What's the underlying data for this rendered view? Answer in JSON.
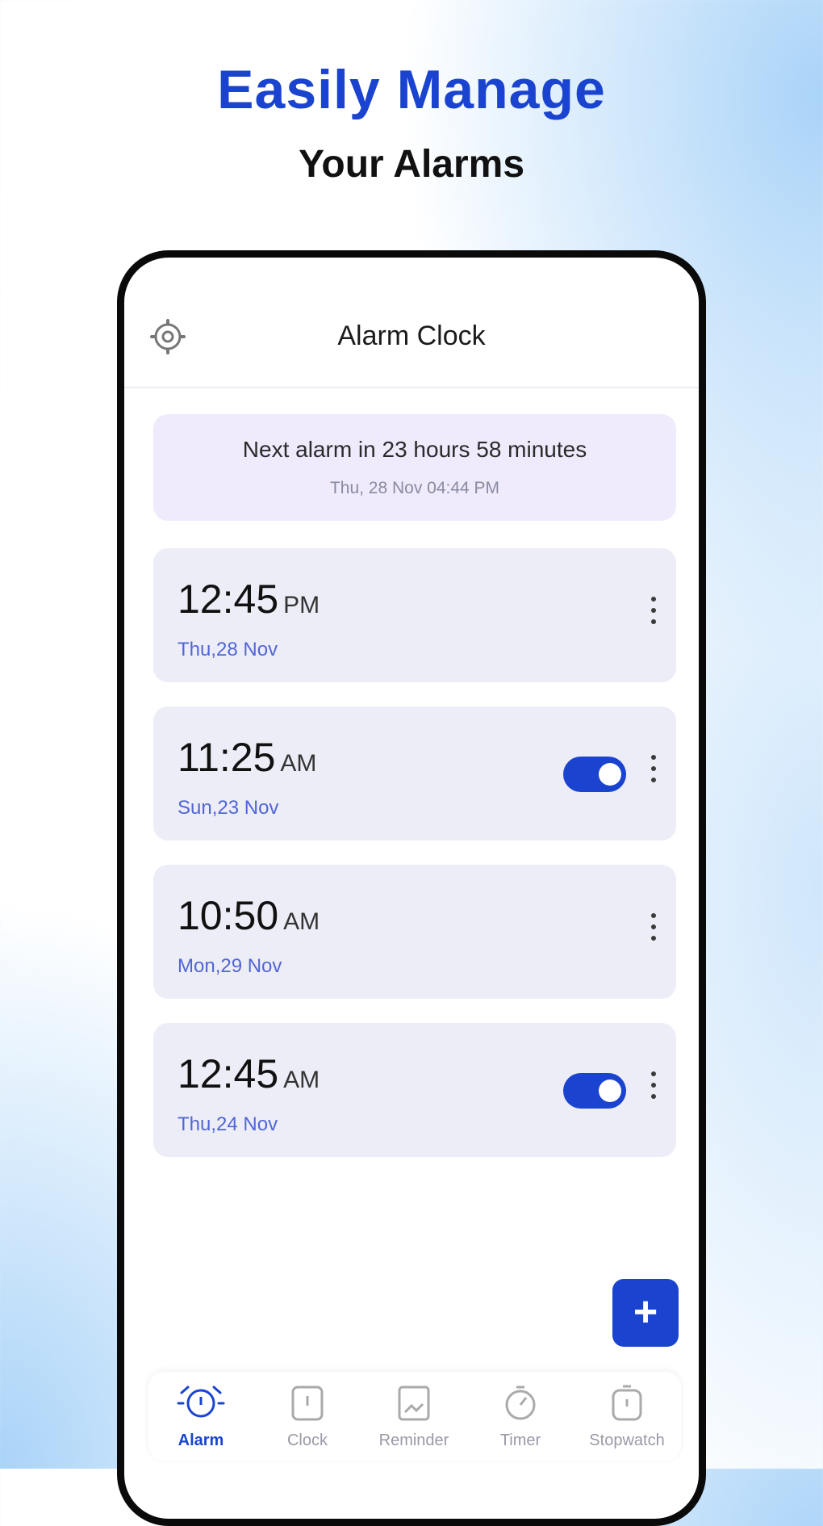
{
  "headline": {
    "title": "Easily Manage",
    "subtitle": "Your Alarms"
  },
  "app": {
    "title": "Alarm Clock",
    "settings_icon": "gear-icon"
  },
  "next_alarm": {
    "text": "Next alarm in 23 hours 58 minutes",
    "when": "Thu, 28 Nov 04:44 PM"
  },
  "alarms": [
    {
      "time": "12:45",
      "ampm": "PM",
      "date": "Thu,28 Nov",
      "toggle_visible": false
    },
    {
      "time": "11:25",
      "ampm": "AM",
      "date": "Sun,23 Nov",
      "toggle_visible": true,
      "enabled": true
    },
    {
      "time": "10:50",
      "ampm": "AM",
      "date": "Mon,29 Nov",
      "toggle_visible": false
    },
    {
      "time": "12:45",
      "ampm": "AM",
      "date": "Thu,24 Nov",
      "toggle_visible": true,
      "enabled": true
    }
  ],
  "fab": {
    "label": "+"
  },
  "nav": {
    "items": [
      {
        "label": "Alarm",
        "icon": "alarm-icon",
        "active": true
      },
      {
        "label": "Clock",
        "icon": "clock-icon",
        "active": false
      },
      {
        "label": "Reminder",
        "icon": "reminder-icon",
        "active": false
      },
      {
        "label": "Timer",
        "icon": "timer-icon",
        "active": false
      },
      {
        "label": "Stopwatch",
        "icon": "stopwatch-icon",
        "active": false
      }
    ]
  },
  "colors": {
    "accent": "#1a44d0",
    "card_bg": "#ededf7",
    "banner_bg": "#efeafc"
  }
}
